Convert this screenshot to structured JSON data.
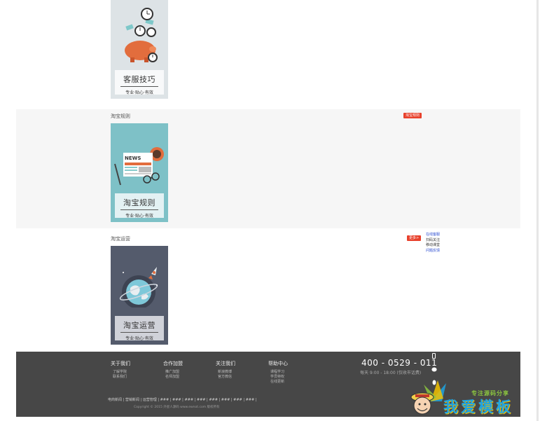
{
  "cards": [
    {
      "title": "客服技巧",
      "subtitle": "专业·贴心·有效",
      "bg": "#dde3e6",
      "icon": "piggy-bank-clock-icon"
    },
    {
      "title": "淘宝规则",
      "subtitle": "专业·贴心·有效",
      "bg": "#7ec1c7",
      "icon": "newspaper-coffee-icon"
    },
    {
      "title": "淘宝运营",
      "subtitle": "专业·贴心·有效",
      "bg": "#545b6c",
      "icon": "globe-rocket-icon"
    }
  ],
  "sections": [
    {
      "title": "淘宝规则",
      "badge": "淘宝规则"
    },
    {
      "title": "淘宝运营",
      "badge": "更多>"
    }
  ],
  "side_links": [
    "在线客服",
    "扫码关注",
    "移动课堂",
    "问题反馈"
  ],
  "footer": {
    "columns": [
      {
        "title": "关于我们",
        "links": [
          "了解学院",
          "联系我们"
        ]
      },
      {
        "title": "合作加盟",
        "links": [
          "推广加盟",
          "名师加盟"
        ]
      },
      {
        "title": "关注我们",
        "links": [
          "新浪微博",
          "官方微信"
        ]
      },
      {
        "title": "帮助中心",
        "links": [
          "课程学习",
          "学员特权",
          "在线更新"
        ]
      }
    ],
    "phone": "400 - 0529 - 011",
    "hours": "每天 9:00 - 18:00 (仅收市话费)",
    "bottom_links": "电商新闻  |  营销新闻  |  运营管理  |  ###  |  ###  |  ###  |  ###  |  ###  |  ###  |  ###  |  ###  |",
    "copyright": "Copyright © 2015 外星人源码 www.ewnot.com 版权所有"
  },
  "watermark": {
    "tagline": "专注源码分享",
    "brand": "我爱模板"
  }
}
